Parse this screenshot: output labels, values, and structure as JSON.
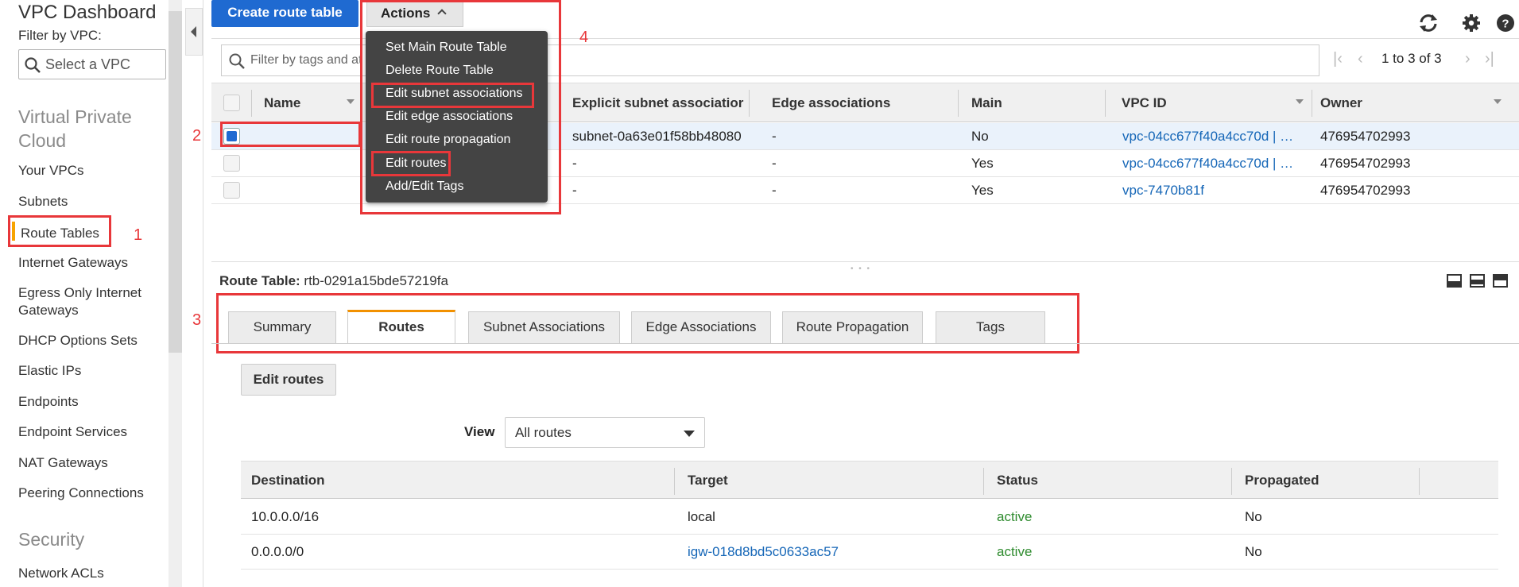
{
  "sidebar": {
    "title": "VPC Dashboard",
    "filter_label": "Filter by VPC:",
    "select_placeholder": "Select a VPC",
    "section_vpc": "Virtual Private Cloud",
    "items": [
      "Your VPCs",
      "Subnets",
      "Route Tables",
      "Internet Gateways",
      "Egress Only Internet Gateways",
      "DHCP Options Sets",
      "Elastic IPs",
      "Endpoints",
      "Endpoint Services",
      "NAT Gateways",
      "Peering Connections"
    ],
    "section_security": "Security",
    "security_items": [
      "Network ACLs"
    ]
  },
  "toolbar": {
    "create_label": "Create route table",
    "actions_label": "Actions"
  },
  "filter": {
    "placeholder": "Filter by tags and at",
    "pager": "1 to 3 of 3"
  },
  "menu": {
    "items": [
      "Set Main Route Table",
      "Delete Route Table",
      "Edit subnet associations",
      "Edit edge associations",
      "Edit route propagation",
      "Edit routes",
      "Add/Edit Tags"
    ]
  },
  "table": {
    "columns": [
      "Name",
      "Explicit subnet associatior",
      "Edge associations",
      "Main",
      "VPC ID",
      "Owner"
    ],
    "rows": [
      {
        "subnet": "subnet-0a63e01f58bb48080",
        "edge": "-",
        "main": "No",
        "vpc": "vpc-04cc677f40a4cc70d | …",
        "owner": "476954702993"
      },
      {
        "subnet": "-",
        "edge": "-",
        "main": "Yes",
        "vpc": "vpc-04cc677f40a4cc70d | …",
        "owner": "476954702993"
      },
      {
        "subnet": "-",
        "edge": "-",
        "main": "Yes",
        "vpc": "vpc-7470b81f",
        "owner": "476954702993"
      }
    ]
  },
  "detail": {
    "label": "Route Table:",
    "id": "rtb-0291a15bde57219fa",
    "tabs": [
      "Summary",
      "Routes",
      "Subnet Associations",
      "Edge Associations",
      "Route Propagation",
      "Tags"
    ],
    "edit_routes_label": "Edit routes",
    "view_label": "View",
    "view_value": "All routes",
    "route_columns": [
      "Destination",
      "Target",
      "Status",
      "Propagated"
    ],
    "routes": [
      {
        "destination": "10.0.0.0/16",
        "target": "local",
        "status": "active",
        "propagated": "No"
      },
      {
        "destination": "0.0.0.0/0",
        "target": "igw-018d8bd5c0633ac57",
        "status": "active",
        "propagated": "No"
      }
    ]
  },
  "annotations": [
    "1",
    "2",
    "3",
    "4"
  ],
  "colors": {
    "accent": "#1f6ad1",
    "highlight": "#e8373a",
    "tab_accent": "#f29100",
    "status_active": "#2e8b2e",
    "link": "#1566b7"
  }
}
